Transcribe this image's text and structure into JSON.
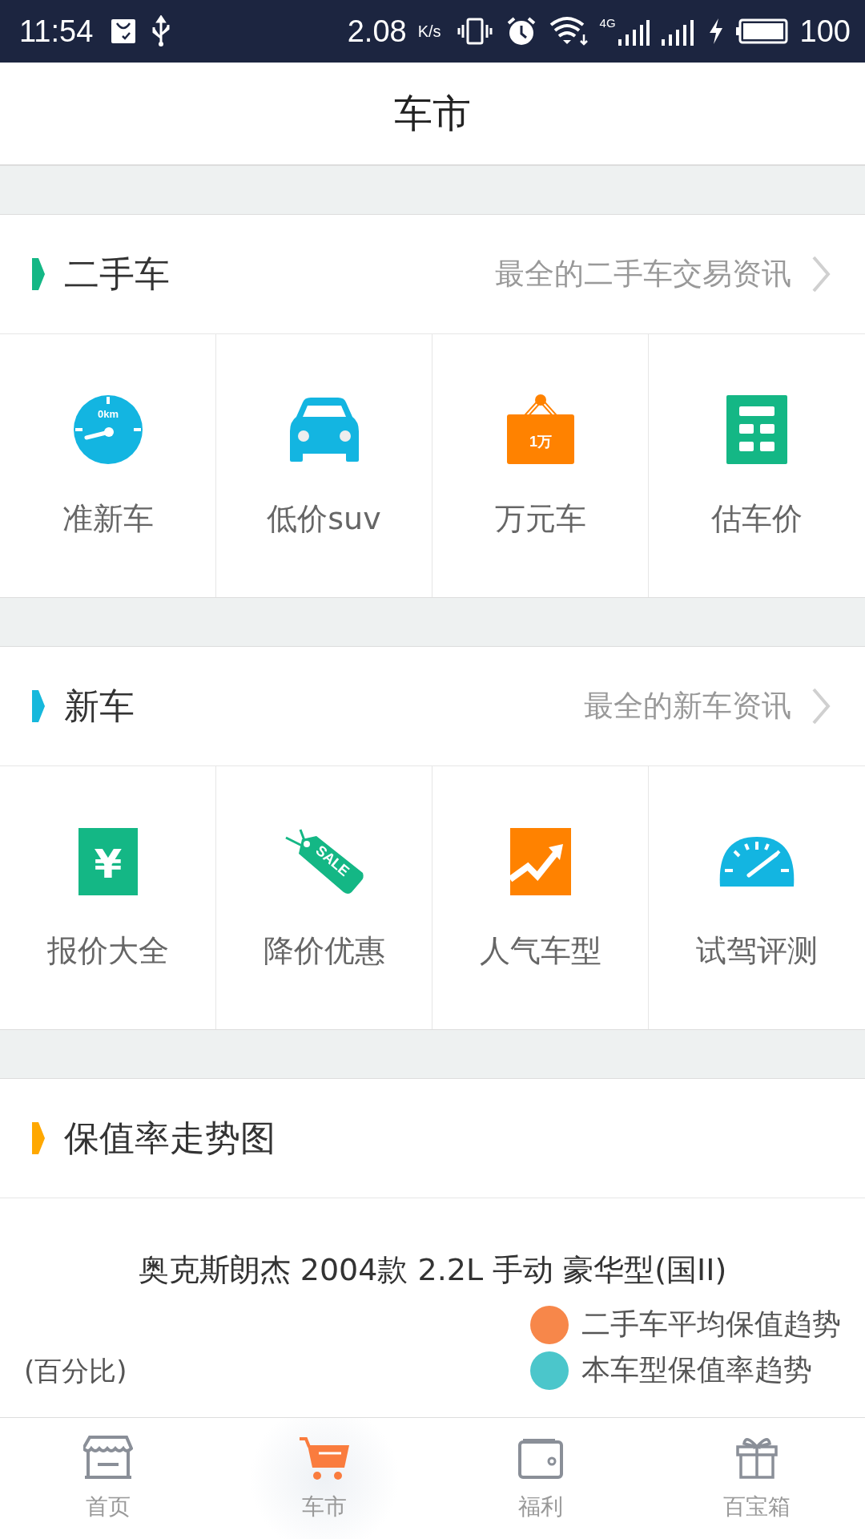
{
  "status_bar": {
    "time": "11:54",
    "speed": "2.08",
    "speed_unit": "K/s",
    "network": "4G",
    "battery": "100"
  },
  "title": "车市",
  "sections": [
    {
      "title": "二手车",
      "color": "#14b785",
      "link": "最全的二手车交易资讯",
      "items": [
        {
          "label": "准新车",
          "icon_label": "0km"
        },
        {
          "label": "低价suv"
        },
        {
          "label": "万元车",
          "icon_label": "1万"
        },
        {
          "label": "估车价"
        }
      ]
    },
    {
      "title": "新车",
      "color": "#16b8dc",
      "link": "最全的新车资讯",
      "items": [
        {
          "label": "报价大全",
          "icon_label": "¥"
        },
        {
          "label": "降价优惠",
          "icon_label": "SALE"
        },
        {
          "label": "人气车型"
        },
        {
          "label": "试驾评测"
        }
      ]
    }
  ],
  "chart": {
    "title": "保值率走势图",
    "color": "#ffa800",
    "subtitle": "奥克斯朗杰 2004款 2.2L 手动 豪华型(国II)",
    "ylabel": "(百分比)",
    "legend": [
      {
        "label": "二手车平均保值趋势",
        "color": "#f7874a"
      },
      {
        "label": "本车型保值率趋势",
        "color": "#4bc6cb"
      }
    ]
  },
  "tabs": [
    {
      "label": "首页",
      "selected": false
    },
    {
      "label": "车市",
      "selected": true
    },
    {
      "label": "福利",
      "selected": false
    },
    {
      "label": "百宝箱",
      "selected": false
    }
  ]
}
